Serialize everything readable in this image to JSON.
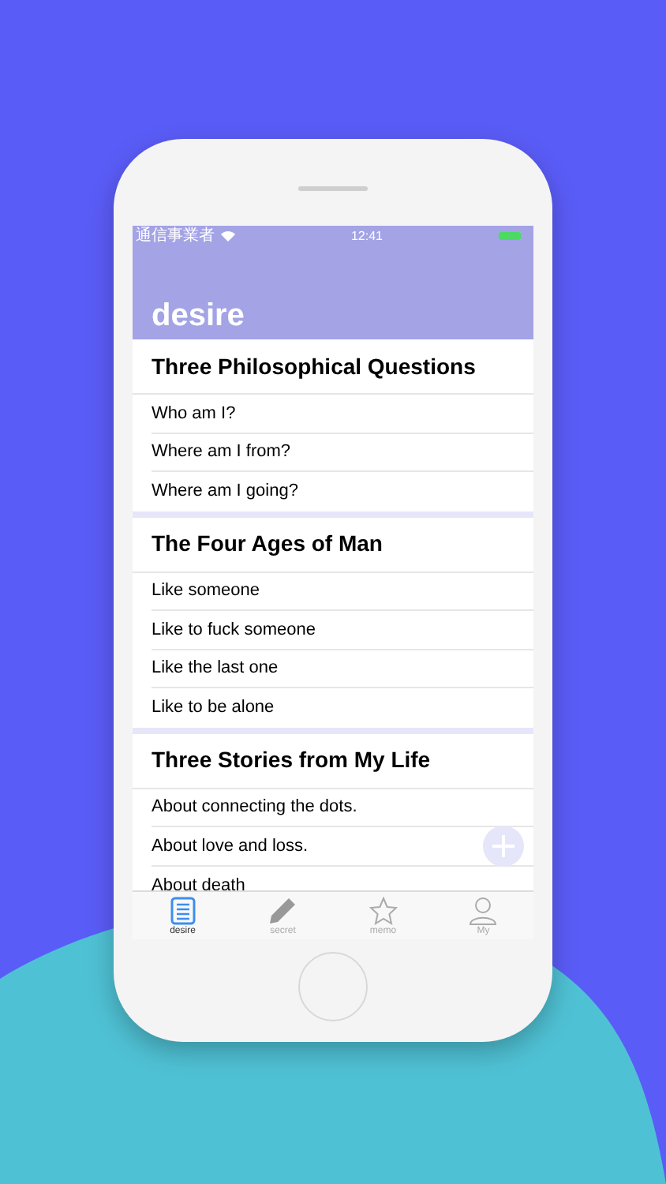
{
  "status_bar": {
    "carrier": "通信事業者",
    "time": "12:41"
  },
  "title": "desire",
  "sections": [
    {
      "title": "Three Philosophical Questions",
      "items": [
        "Who am I?",
        "Where am I from?",
        "Where am I going?"
      ]
    },
    {
      "title": "The Four Ages of Man",
      "items": [
        "Like someone",
        "Like to fuck someone",
        "Like the last one",
        "Like to be alone"
      ]
    },
    {
      "title": "Three Stories from My Life",
      "items": [
        "About connecting the dots.",
        "About love and loss.",
        "About death"
      ]
    }
  ],
  "tabs": [
    {
      "label": "desire",
      "selected": true
    },
    {
      "label": "secret",
      "selected": false
    },
    {
      "label": "memo",
      "selected": false
    },
    {
      "label": "My",
      "selected": false
    }
  ]
}
